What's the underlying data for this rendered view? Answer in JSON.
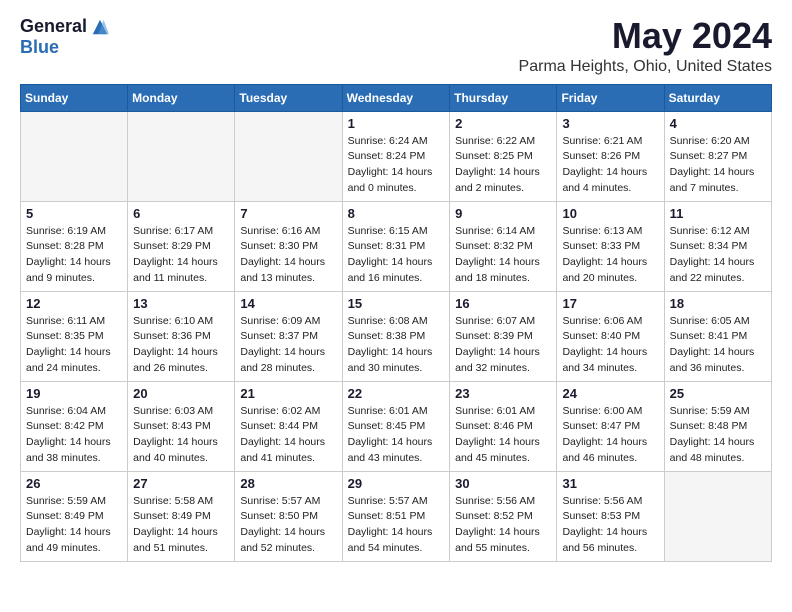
{
  "logo": {
    "general": "General",
    "blue": "Blue"
  },
  "title": "May 2024",
  "location": "Parma Heights, Ohio, United States",
  "days_of_week": [
    "Sunday",
    "Monday",
    "Tuesday",
    "Wednesday",
    "Thursday",
    "Friday",
    "Saturday"
  ],
  "weeks": [
    [
      {
        "day": "",
        "sunrise": "",
        "sunset": "",
        "daylight": "",
        "empty": true
      },
      {
        "day": "",
        "sunrise": "",
        "sunset": "",
        "daylight": "",
        "empty": true
      },
      {
        "day": "",
        "sunrise": "",
        "sunset": "",
        "daylight": "",
        "empty": true
      },
      {
        "day": "1",
        "sunrise": "Sunrise: 6:24 AM",
        "sunset": "Sunset: 8:24 PM",
        "daylight": "Daylight: 14 hours and 0 minutes.",
        "empty": false
      },
      {
        "day": "2",
        "sunrise": "Sunrise: 6:22 AM",
        "sunset": "Sunset: 8:25 PM",
        "daylight": "Daylight: 14 hours and 2 minutes.",
        "empty": false
      },
      {
        "day": "3",
        "sunrise": "Sunrise: 6:21 AM",
        "sunset": "Sunset: 8:26 PM",
        "daylight": "Daylight: 14 hours and 4 minutes.",
        "empty": false
      },
      {
        "day": "4",
        "sunrise": "Sunrise: 6:20 AM",
        "sunset": "Sunset: 8:27 PM",
        "daylight": "Daylight: 14 hours and 7 minutes.",
        "empty": false
      }
    ],
    [
      {
        "day": "5",
        "sunrise": "Sunrise: 6:19 AM",
        "sunset": "Sunset: 8:28 PM",
        "daylight": "Daylight: 14 hours and 9 minutes.",
        "empty": false
      },
      {
        "day": "6",
        "sunrise": "Sunrise: 6:17 AM",
        "sunset": "Sunset: 8:29 PM",
        "daylight": "Daylight: 14 hours and 11 minutes.",
        "empty": false
      },
      {
        "day": "7",
        "sunrise": "Sunrise: 6:16 AM",
        "sunset": "Sunset: 8:30 PM",
        "daylight": "Daylight: 14 hours and 13 minutes.",
        "empty": false
      },
      {
        "day": "8",
        "sunrise": "Sunrise: 6:15 AM",
        "sunset": "Sunset: 8:31 PM",
        "daylight": "Daylight: 14 hours and 16 minutes.",
        "empty": false
      },
      {
        "day": "9",
        "sunrise": "Sunrise: 6:14 AM",
        "sunset": "Sunset: 8:32 PM",
        "daylight": "Daylight: 14 hours and 18 minutes.",
        "empty": false
      },
      {
        "day": "10",
        "sunrise": "Sunrise: 6:13 AM",
        "sunset": "Sunset: 8:33 PM",
        "daylight": "Daylight: 14 hours and 20 minutes.",
        "empty": false
      },
      {
        "day": "11",
        "sunrise": "Sunrise: 6:12 AM",
        "sunset": "Sunset: 8:34 PM",
        "daylight": "Daylight: 14 hours and 22 minutes.",
        "empty": false
      }
    ],
    [
      {
        "day": "12",
        "sunrise": "Sunrise: 6:11 AM",
        "sunset": "Sunset: 8:35 PM",
        "daylight": "Daylight: 14 hours and 24 minutes.",
        "empty": false
      },
      {
        "day": "13",
        "sunrise": "Sunrise: 6:10 AM",
        "sunset": "Sunset: 8:36 PM",
        "daylight": "Daylight: 14 hours and 26 minutes.",
        "empty": false
      },
      {
        "day": "14",
        "sunrise": "Sunrise: 6:09 AM",
        "sunset": "Sunset: 8:37 PM",
        "daylight": "Daylight: 14 hours and 28 minutes.",
        "empty": false
      },
      {
        "day": "15",
        "sunrise": "Sunrise: 6:08 AM",
        "sunset": "Sunset: 8:38 PM",
        "daylight": "Daylight: 14 hours and 30 minutes.",
        "empty": false
      },
      {
        "day": "16",
        "sunrise": "Sunrise: 6:07 AM",
        "sunset": "Sunset: 8:39 PM",
        "daylight": "Daylight: 14 hours and 32 minutes.",
        "empty": false
      },
      {
        "day": "17",
        "sunrise": "Sunrise: 6:06 AM",
        "sunset": "Sunset: 8:40 PM",
        "daylight": "Daylight: 14 hours and 34 minutes.",
        "empty": false
      },
      {
        "day": "18",
        "sunrise": "Sunrise: 6:05 AM",
        "sunset": "Sunset: 8:41 PM",
        "daylight": "Daylight: 14 hours and 36 minutes.",
        "empty": false
      }
    ],
    [
      {
        "day": "19",
        "sunrise": "Sunrise: 6:04 AM",
        "sunset": "Sunset: 8:42 PM",
        "daylight": "Daylight: 14 hours and 38 minutes.",
        "empty": false
      },
      {
        "day": "20",
        "sunrise": "Sunrise: 6:03 AM",
        "sunset": "Sunset: 8:43 PM",
        "daylight": "Daylight: 14 hours and 40 minutes.",
        "empty": false
      },
      {
        "day": "21",
        "sunrise": "Sunrise: 6:02 AM",
        "sunset": "Sunset: 8:44 PM",
        "daylight": "Daylight: 14 hours and 41 minutes.",
        "empty": false
      },
      {
        "day": "22",
        "sunrise": "Sunrise: 6:01 AM",
        "sunset": "Sunset: 8:45 PM",
        "daylight": "Daylight: 14 hours and 43 minutes.",
        "empty": false
      },
      {
        "day": "23",
        "sunrise": "Sunrise: 6:01 AM",
        "sunset": "Sunset: 8:46 PM",
        "daylight": "Daylight: 14 hours and 45 minutes.",
        "empty": false
      },
      {
        "day": "24",
        "sunrise": "Sunrise: 6:00 AM",
        "sunset": "Sunset: 8:47 PM",
        "daylight": "Daylight: 14 hours and 46 minutes.",
        "empty": false
      },
      {
        "day": "25",
        "sunrise": "Sunrise: 5:59 AM",
        "sunset": "Sunset: 8:48 PM",
        "daylight": "Daylight: 14 hours and 48 minutes.",
        "empty": false
      }
    ],
    [
      {
        "day": "26",
        "sunrise": "Sunrise: 5:59 AM",
        "sunset": "Sunset: 8:49 PM",
        "daylight": "Daylight: 14 hours and 49 minutes.",
        "empty": false
      },
      {
        "day": "27",
        "sunrise": "Sunrise: 5:58 AM",
        "sunset": "Sunset: 8:49 PM",
        "daylight": "Daylight: 14 hours and 51 minutes.",
        "empty": false
      },
      {
        "day": "28",
        "sunrise": "Sunrise: 5:57 AM",
        "sunset": "Sunset: 8:50 PM",
        "daylight": "Daylight: 14 hours and 52 minutes.",
        "empty": false
      },
      {
        "day": "29",
        "sunrise": "Sunrise: 5:57 AM",
        "sunset": "Sunset: 8:51 PM",
        "daylight": "Daylight: 14 hours and 54 minutes.",
        "empty": false
      },
      {
        "day": "30",
        "sunrise": "Sunrise: 5:56 AM",
        "sunset": "Sunset: 8:52 PM",
        "daylight": "Daylight: 14 hours and 55 minutes.",
        "empty": false
      },
      {
        "day": "31",
        "sunrise": "Sunrise: 5:56 AM",
        "sunset": "Sunset: 8:53 PM",
        "daylight": "Daylight: 14 hours and 56 minutes.",
        "empty": false
      },
      {
        "day": "",
        "sunrise": "",
        "sunset": "",
        "daylight": "",
        "empty": true
      }
    ]
  ]
}
